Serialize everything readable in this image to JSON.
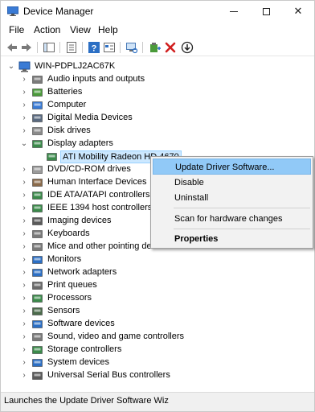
{
  "window": {
    "title": "Device Manager",
    "minimize_icon": "minimize-icon",
    "maximize_icon": "maximize-icon",
    "close_label": "✕"
  },
  "menu": [
    "File",
    "Action",
    "View",
    "Help"
  ],
  "toolbar_icons": [
    "back-arrow-icon",
    "forward-arrow-icon",
    "show-hide-tree-icon",
    "properties-icon",
    "help-icon",
    "view-icon",
    "scan-hardware-icon",
    "add-driver-icon",
    "uninstall-icon",
    "update-driver-icon"
  ],
  "tree": {
    "root": "WIN-PDPLJ2AC67K",
    "categories": [
      {
        "label": "Audio inputs and outputs",
        "icon": "audio-icon"
      },
      {
        "label": "Batteries",
        "icon": "battery-icon"
      },
      {
        "label": "Computer",
        "icon": "computer-icon"
      },
      {
        "label": "Digital Media Devices",
        "icon": "media-device-icon"
      },
      {
        "label": "Disk drives",
        "icon": "disk-drive-icon"
      },
      {
        "label": "Display adapters",
        "icon": "display-adapter-icon",
        "expanded": true
      },
      {
        "label": "ATI Mobility Radeon HD 4670",
        "icon": "display-adapter-icon",
        "child": true,
        "selected": true
      },
      {
        "label": "DVD/CD-ROM drives",
        "icon": "dvd-icon"
      },
      {
        "label": "Human Interface Devices",
        "icon": "hid-icon"
      },
      {
        "label": "IDE ATA/ATAPI controllers",
        "icon": "ide-controller-icon"
      },
      {
        "label": "IEEE 1394 host controllers",
        "icon": "ieee1394-icon"
      },
      {
        "label": "Imaging devices",
        "icon": "camera-icon"
      },
      {
        "label": "Keyboards",
        "icon": "keyboard-icon"
      },
      {
        "label": "Mice and other pointing devices",
        "icon": "mouse-icon"
      },
      {
        "label": "Monitors",
        "icon": "monitor-icon"
      },
      {
        "label": "Network adapters",
        "icon": "network-icon"
      },
      {
        "label": "Print queues",
        "icon": "printer-icon"
      },
      {
        "label": "Processors",
        "icon": "processor-icon"
      },
      {
        "label": "Sensors",
        "icon": "sensor-icon"
      },
      {
        "label": "Software devices",
        "icon": "software-device-icon"
      },
      {
        "label": "Sound, video and game controllers",
        "icon": "sound-icon"
      },
      {
        "label": "Storage controllers",
        "icon": "storage-icon"
      },
      {
        "label": "System devices",
        "icon": "system-device-icon"
      },
      {
        "label": "Universal Serial Bus controllers",
        "icon": "usb-icon"
      }
    ]
  },
  "context_menu": {
    "items": [
      {
        "label": "Update Driver Software...",
        "highlighted": true
      },
      {
        "label": "Disable"
      },
      {
        "label": "Uninstall"
      },
      {
        "label": "Scan for hardware changes"
      },
      {
        "label": "Properties",
        "bold": true
      }
    ]
  },
  "status": "Launches the Update Driver Software Wiz",
  "colors": {
    "selection_bg": "#cce8ff",
    "menu_highlight": "#91c9f7",
    "accent_blue": "#1e73be"
  }
}
